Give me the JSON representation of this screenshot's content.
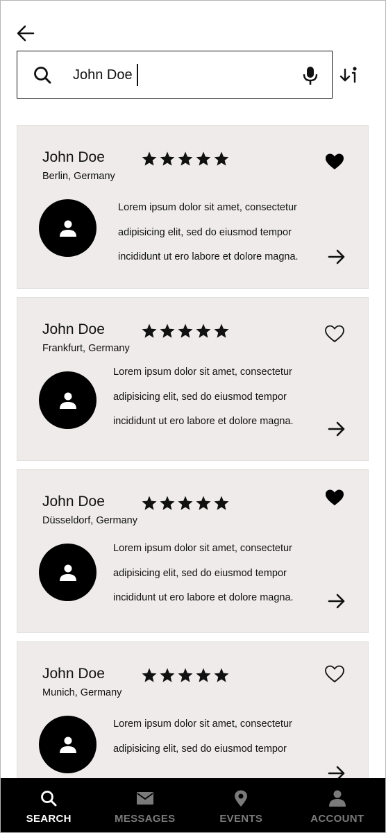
{
  "search": {
    "value": "John Doe"
  },
  "results": [
    {
      "name": "John Doe",
      "location": "Berlin, Germany",
      "rating": 5,
      "favorited": true,
      "description": [
        "Lorem ipsum dolor sit amet, consectetur",
        "adipisicing elit, sed do eiusmod tempor",
        "incididunt ut ero labore et dolore magna."
      ]
    },
    {
      "name": "John Doe",
      "location": "Frankfurt, Germany",
      "rating": 5,
      "favorited": false,
      "description": [
        "Lorem ipsum dolor sit amet, consectetur",
        "adipisicing elit, sed do eiusmod tempor",
        "incididunt ut ero labore et dolore magna."
      ]
    },
    {
      "name": "John Doe",
      "location": "Düsseldorf, Germany",
      "rating": 5,
      "favorited": true,
      "description": [
        "Lorem ipsum dolor sit amet, consectetur",
        "adipisicing elit, sed do eiusmod tempor",
        "incididunt ut ero labore et dolore magna."
      ]
    },
    {
      "name": "John Doe",
      "location": "Munich, Germany",
      "rating": 5,
      "favorited": false,
      "description": [
        "Lorem ipsum dolor sit amet, consectetur",
        "adipisicing elit, sed do eiusmod tempor"
      ]
    }
  ],
  "nav": {
    "items": [
      {
        "label": "SEARCH",
        "icon": "search-icon",
        "active": true
      },
      {
        "label": "MESSAGES",
        "icon": "mail-icon",
        "active": false
      },
      {
        "label": "EVENTS",
        "icon": "location-pin-icon",
        "active": false
      },
      {
        "label": "ACCOUNT",
        "icon": "person-icon",
        "active": false
      }
    ]
  },
  "colors": {
    "card_bg": "#eeebea",
    "nav_bg": "#000000",
    "nav_active": "#ffffff",
    "nav_inactive": "#7a7a7a"
  }
}
